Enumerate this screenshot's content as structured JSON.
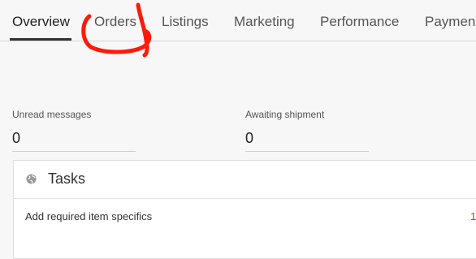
{
  "nav": {
    "tabs": [
      {
        "label": "Overview",
        "active": true
      },
      {
        "label": "Orders",
        "active": false
      },
      {
        "label": "Listings",
        "active": false
      },
      {
        "label": "Marketing",
        "active": false
      },
      {
        "label": "Performance",
        "active": false
      },
      {
        "label": "Paymen",
        "active": false
      }
    ]
  },
  "annotation": {
    "color": "#ff1a0a"
  },
  "metrics": [
    {
      "label": "Unread messages",
      "value": "0"
    },
    {
      "label": "Awaiting shipment",
      "value": "0"
    }
  ],
  "tasks": {
    "title": "Tasks",
    "items": [
      {
        "label": "Add required item specifics",
        "count": "1"
      }
    ]
  },
  "colors": {
    "accent_red": "#c0392b"
  }
}
